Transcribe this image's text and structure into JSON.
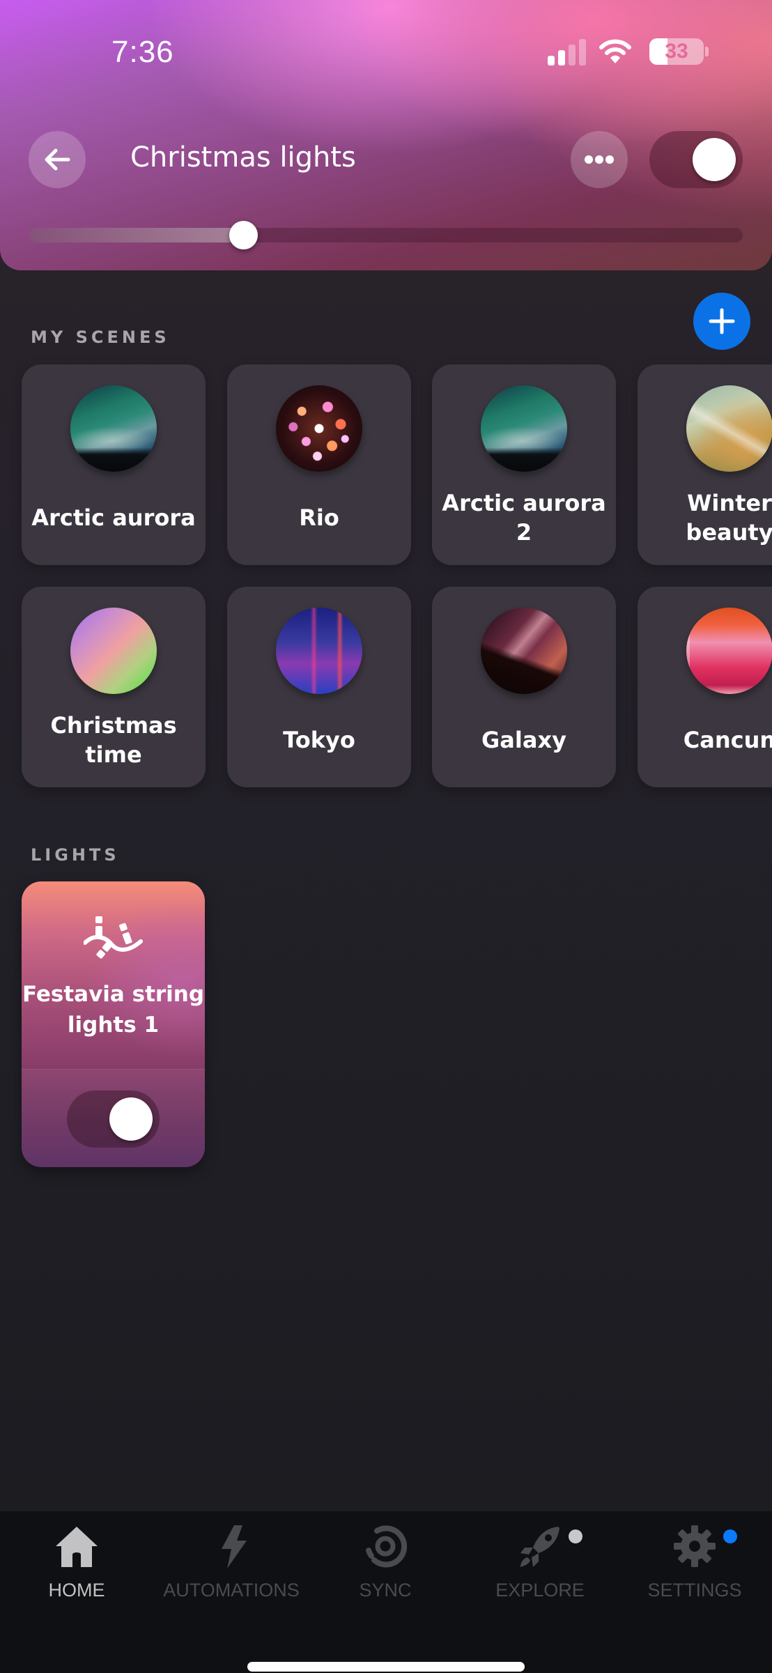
{
  "status_bar": {
    "time": "7:36",
    "battery": "33",
    "battery_percent": 33
  },
  "header": {
    "title": "Christmas lights",
    "back_icon": "arrow-left-icon",
    "more_icon": "ellipsis-icon",
    "power_on": true,
    "brightness_percent": 30,
    "gradient_colors": [
      "#c85cf0",
      "#ff8ce6",
      "#ff78aa",
      "#8a447c",
      "#6e3a3c"
    ]
  },
  "scenes": {
    "label": "MY SCENES",
    "add_icon": "plus-icon",
    "items": [
      {
        "name": "Arctic aurora",
        "image": "aurora"
      },
      {
        "name": "Rio",
        "image": "rio"
      },
      {
        "name": "Arctic aurora 2",
        "image": "aurora"
      },
      {
        "name": "Winter beauty",
        "image": "winter"
      },
      {
        "name": "Christmas time",
        "image": "xmas"
      },
      {
        "name": "Tokyo",
        "image": "tokyo"
      },
      {
        "name": "Galaxy",
        "image": "galaxy"
      },
      {
        "name": "Cancun",
        "image": "cancun"
      }
    ]
  },
  "lights": {
    "label": "LIGHTS",
    "items": [
      {
        "name": "Festavia string lights 1",
        "icon": "string-lights-icon",
        "on": true
      }
    ]
  },
  "bottom_nav": {
    "items": [
      {
        "label": "HOME",
        "icon": "home-icon",
        "active": true,
        "badge": null
      },
      {
        "label": "AUTOMATIONS",
        "icon": "lightning-icon",
        "active": false,
        "badge": null
      },
      {
        "label": "SYNC",
        "icon": "sync-icon",
        "active": false,
        "badge": null
      },
      {
        "label": "EXPLORE",
        "icon": "rocket-icon",
        "active": false,
        "badge": "#c8c8ca"
      },
      {
        "label": "SETTINGS",
        "icon": "gear-icon",
        "active": false,
        "badge": "#0a7aff"
      }
    ]
  },
  "colors": {
    "accent": "#0a72e6",
    "card_bg": "#3b363f",
    "nav_bg": "#0f1013"
  }
}
